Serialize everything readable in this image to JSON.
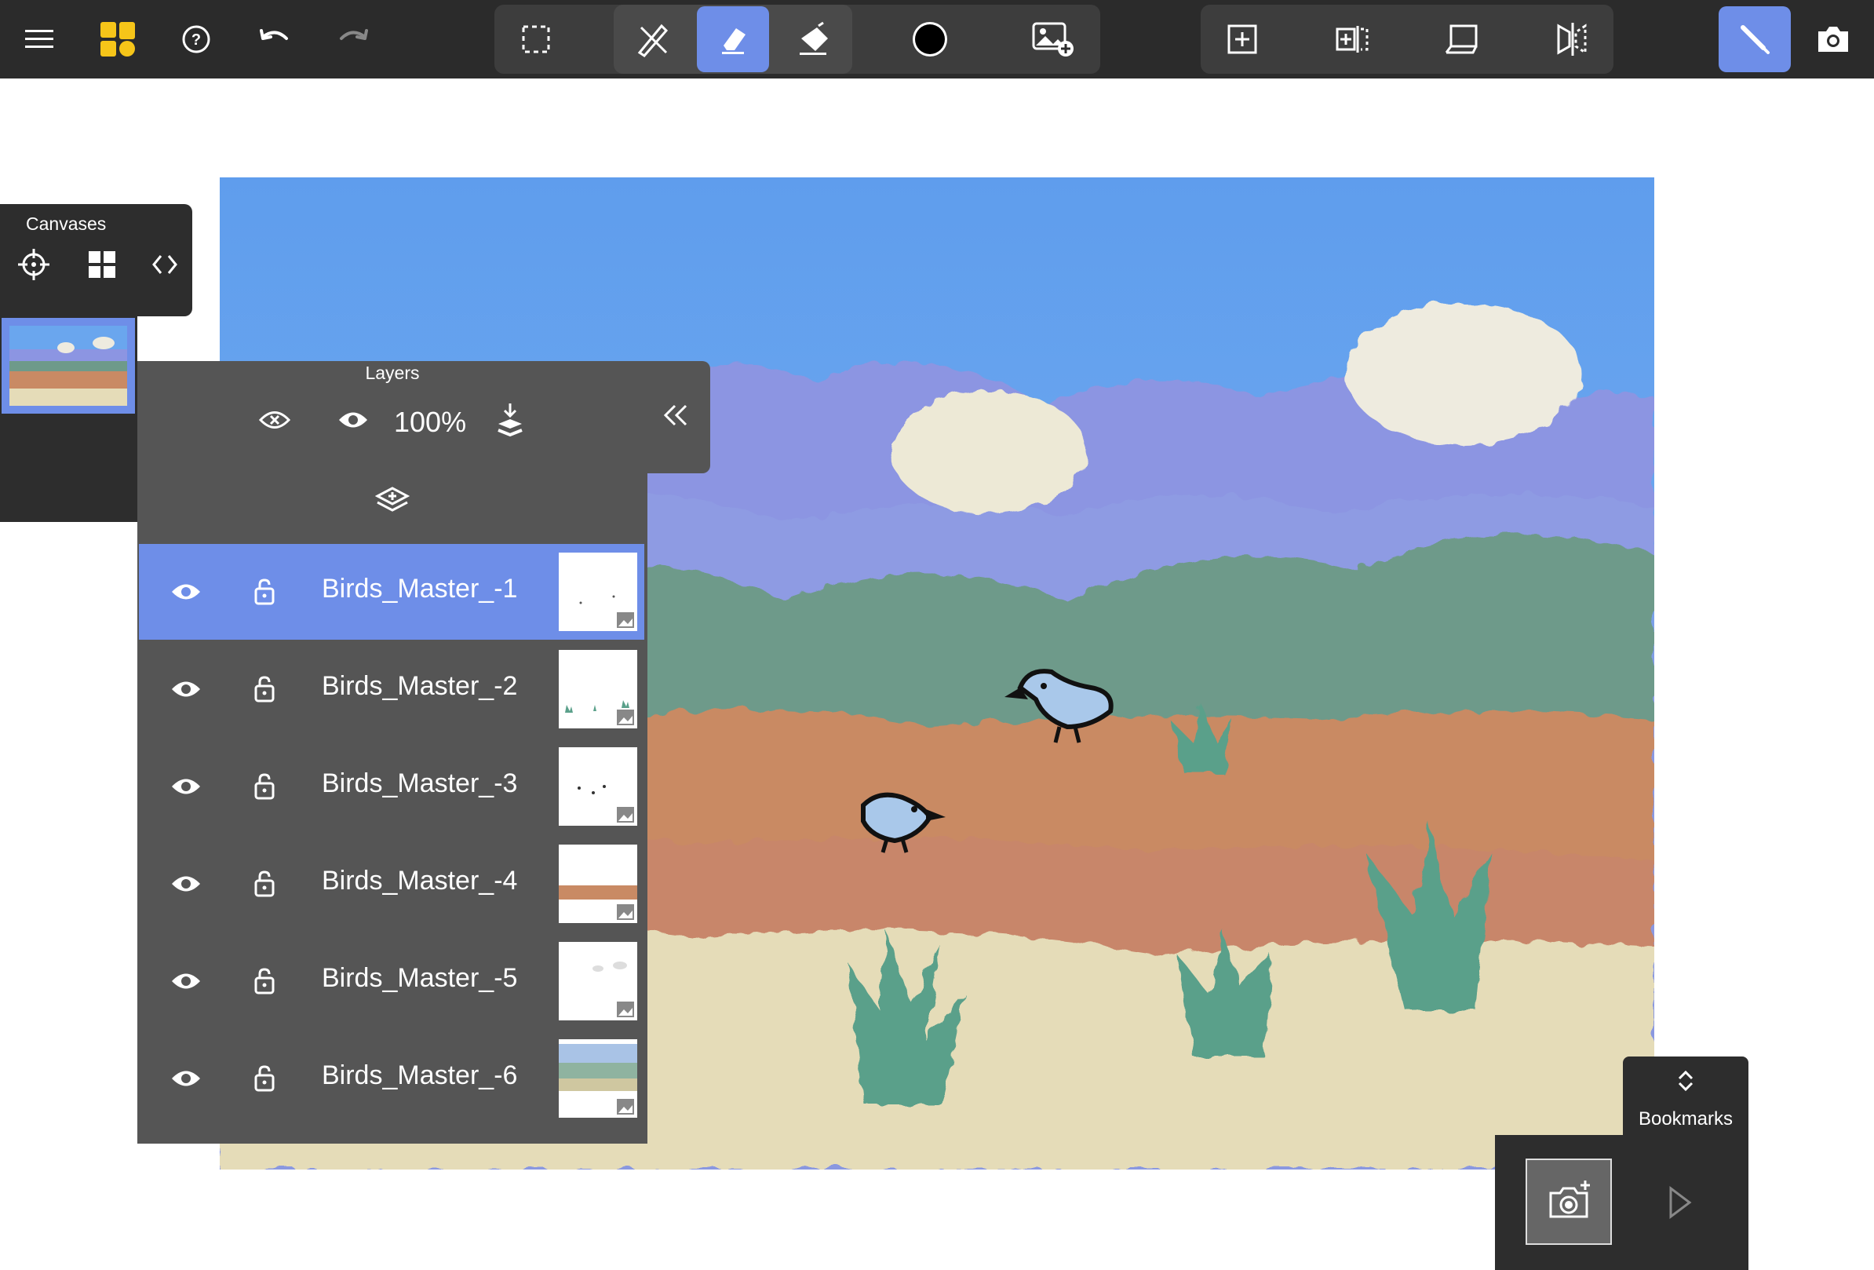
{
  "toolbar": {
    "tools": [
      "menu-icon",
      "app-logo",
      "help-icon",
      "undo-icon",
      "redo-icon",
      "selection-icon",
      "pencil-ruler-icon",
      "eraser-icon",
      "fill-icon",
      "color-swatch",
      "add-image-icon",
      "new-canvas-icon",
      "add-frame-icon",
      "perspective-icon",
      "symmetry-icon",
      "brush-mode-icon",
      "camera-icon"
    ],
    "active_tool": "eraser",
    "color": "#000000",
    "accent": "#6e8ee8",
    "logo_color": "#f6c519"
  },
  "canvases": {
    "title": "Canvases"
  },
  "layers": {
    "title": "Layers",
    "opacity": "100%",
    "items": [
      {
        "name": "Birds_Master_-1",
        "selected": true
      },
      {
        "name": "Birds_Master_-2",
        "selected": false
      },
      {
        "name": "Birds_Master_-3",
        "selected": false
      },
      {
        "name": "Birds_Master_-4",
        "selected": false
      },
      {
        "name": "Birds_Master_-5",
        "selected": false
      },
      {
        "name": "Birds_Master_-6",
        "selected": false
      }
    ]
  },
  "bookmarks": {
    "label": "Bookmarks"
  }
}
